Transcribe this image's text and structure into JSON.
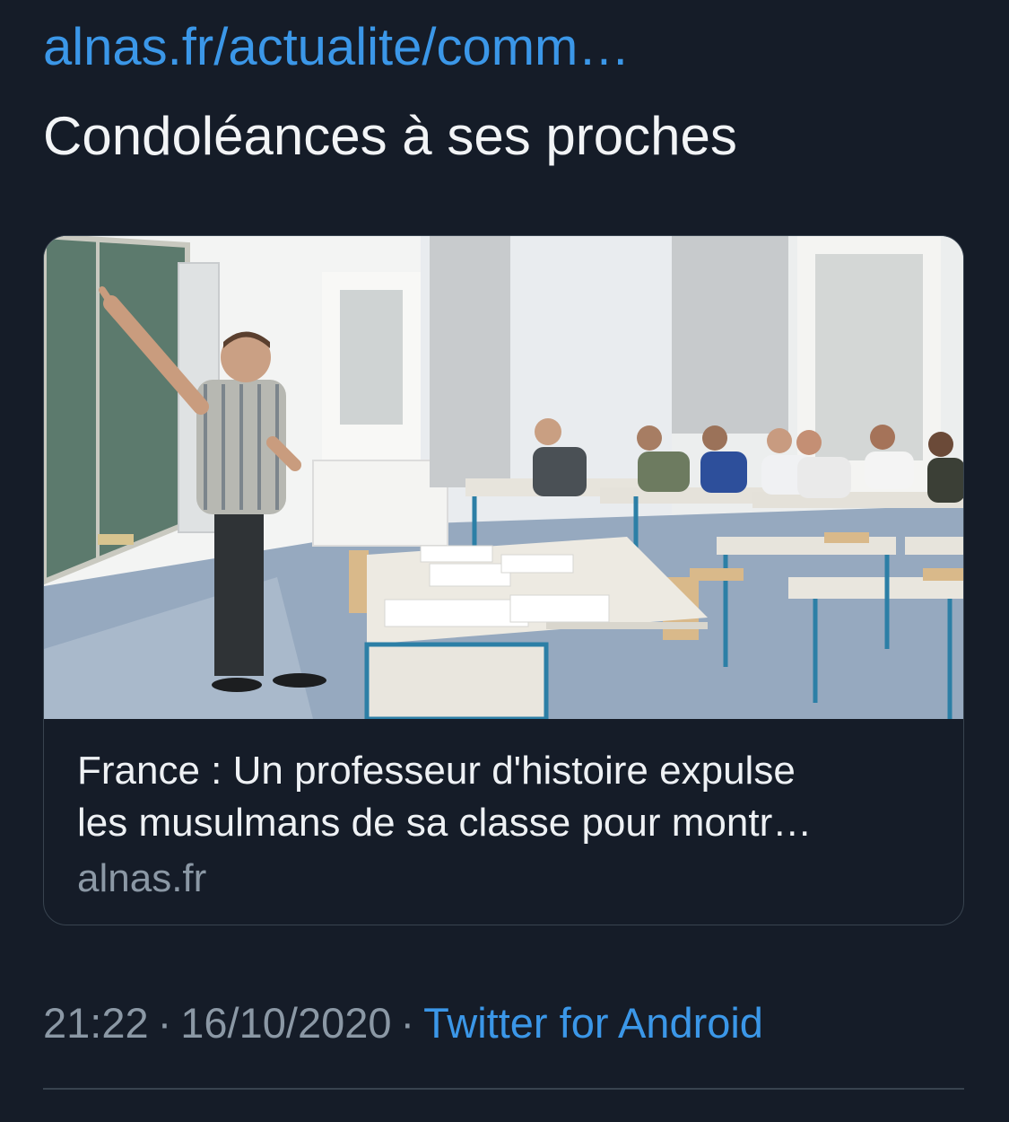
{
  "tweet": {
    "link_text": "alnas.fr/actualite/comm…",
    "text": "Condoléances à ses proches"
  },
  "card": {
    "image_icon": "classroom-photo",
    "title_line1": "France : Un professeur d'histoire expulse",
    "title_line2": "les musulmans de sa classe pour montr…",
    "domain": "alnas.fr"
  },
  "meta": {
    "time": "21:22",
    "separator": "·",
    "date": "16/10/2020",
    "source": "Twitter for Android"
  },
  "colors": {
    "background": "#151c28",
    "link": "#3b97e8",
    "muted": "#8b98a5",
    "border": "#38434f"
  }
}
